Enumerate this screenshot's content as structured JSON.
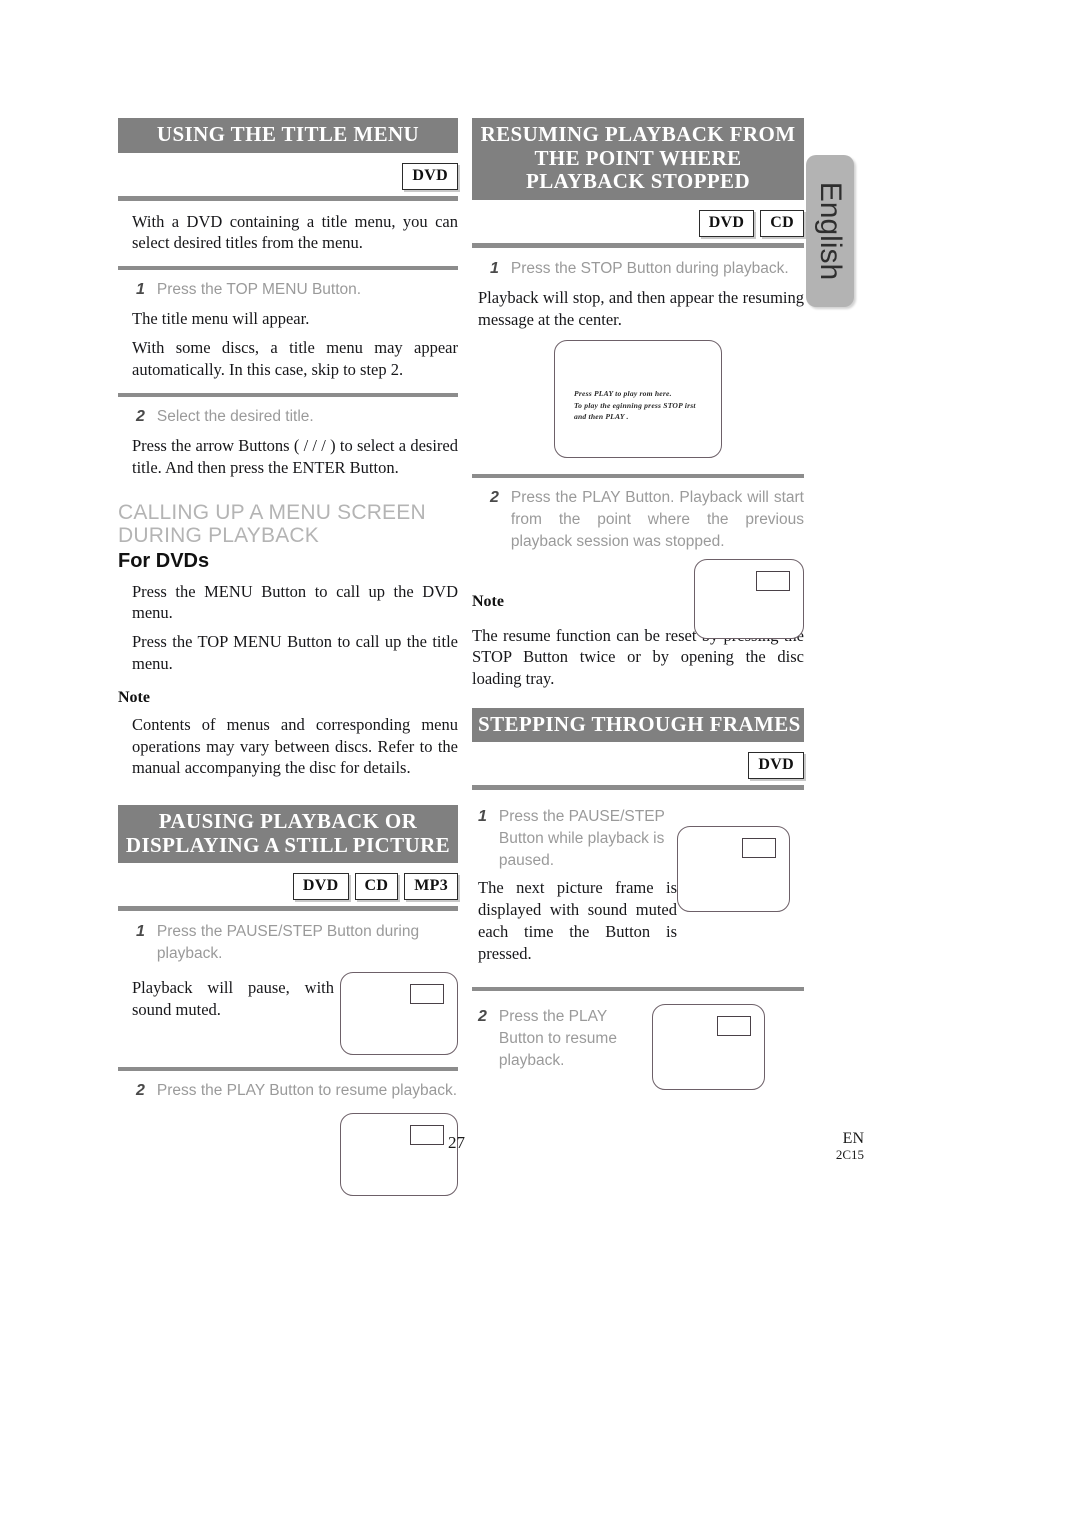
{
  "language_tab": {
    "label": "English"
  },
  "sections": {
    "title_menu": {
      "heading_lines": [
        "USING THE TITLE MENU"
      ],
      "badges": [
        "DVD"
      ],
      "intro": "With a DVD containing a title menu, you can select desired titles from the menu.",
      "step1_num": "1",
      "step1_text": "Press the TOP MENU Button.",
      "step1_body": "The title menu will appear.",
      "step1_body2": "With some discs, a title menu may appear automatically. In this case, skip to step 2.",
      "step2_num": "2",
      "step2_text": "Select the desired title.",
      "step2_body": "Press the arrow Buttons (  /  /  /  ) to select a desired title. And then press the ENTER Button."
    },
    "calling_menu": {
      "subhead_line1": "CALLING UP A MENU SCREEN",
      "subhead_line2": "DURING PLAYBACK",
      "subhead_black": "For DVDs",
      "body1": "Press the MENU Button to call up the DVD menu.",
      "body2": "Press the TOP MENU Button to call up the title menu.",
      "note_label": "Note",
      "note_body": "Contents of menus and corresponding menu operations may vary between discs. Refer to the manual accompanying the disc for details."
    },
    "resuming": {
      "heading_lines": [
        "RESUMING PLAYBACK FROM",
        "THE POINT WHERE",
        "PLAYBACK STOPPED"
      ],
      "badges": [
        "DVD",
        "CD"
      ],
      "step1_num": "1",
      "step1_text": "Press the STOP Button during playback.",
      "step1_body": "Playback will stop, and then appear the resuming message at the center.",
      "osd_line1": "Press  PLAY  to play  rom here.",
      "osd_line2": "To play the  eginning  press  STOP   irst",
      "osd_line3": "and then  PLAY .",
      "step2_num": "2",
      "step2_text": "Press the PLAY Button. Playback will start from the point where the previous playback session was stopped.",
      "note_label": "Note",
      "note_body": "The resume function can be reset by pressing the STOP Button twice or by opening the disc loading tray."
    },
    "pausing": {
      "heading_lines": [
        "PAUSING PLAYBACK OR",
        "DISPLAYING A STILL PICTURE"
      ],
      "badges": [
        "DVD",
        "CD",
        "MP3"
      ],
      "step1_num": "1",
      "step1_text": "Press the PAUSE/STEP Button during playback.",
      "step1_body": "Playback will pause, with sound muted.",
      "step2_num": "2",
      "step2_text": "Press the PLAY Button to resume playback."
    },
    "stepping": {
      "heading_lines": [
        "STEPPING THROUGH FRAMES"
      ],
      "badges": [
        "DVD"
      ],
      "step1_num": "1",
      "step1_text": "Press the PAUSE/STEP Button while playback is paused.",
      "step1_body": "The next picture frame is displayed with sound muted each time the Button is pressed.",
      "step2_num": "2",
      "step2_text": "Press the PLAY Button to resume playback."
    }
  },
  "footer": {
    "page_number": "27",
    "lang_code": "EN",
    "doc_code": "2C15"
  }
}
